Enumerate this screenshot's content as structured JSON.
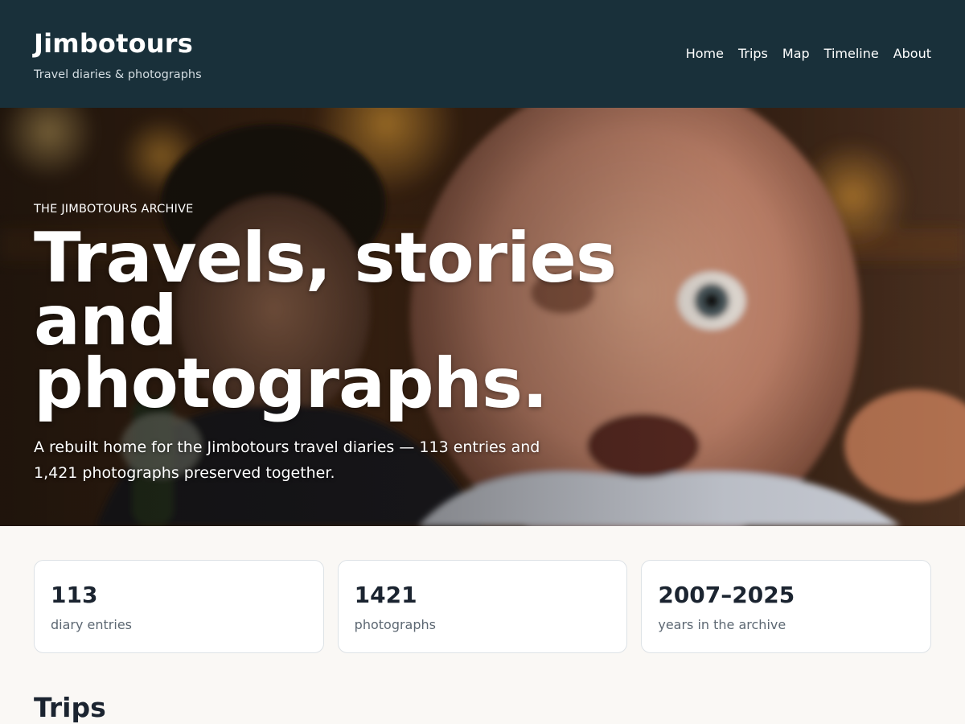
{
  "header": {
    "site_title": "Jimbotours",
    "tagline": "Travel diaries & photographs",
    "nav": [
      "Home",
      "Trips",
      "Map",
      "Timeline",
      "About"
    ]
  },
  "hero": {
    "eyebrow": "THE JIMBOTOURS ARCHIVE",
    "title_line1": "Travels, stories",
    "title_line2": "and photographs.",
    "lede": "A rebuilt home for the Jimbotours travel diaries — 113 entries and 1,421 photographs preserved together."
  },
  "stats": [
    {
      "value": "113",
      "label": "diary entries"
    },
    {
      "value": "1421",
      "label": "photographs"
    },
    {
      "value": "2007–2025",
      "label": "years in the archive"
    }
  ],
  "sections": {
    "trips_title": "Trips"
  },
  "colors": {
    "header_bg": "#19303a",
    "page_bg": "#faf8f5",
    "card_border": "#dde2e6",
    "text_dark": "#1b2430",
    "text_muted": "#5d6873"
  }
}
